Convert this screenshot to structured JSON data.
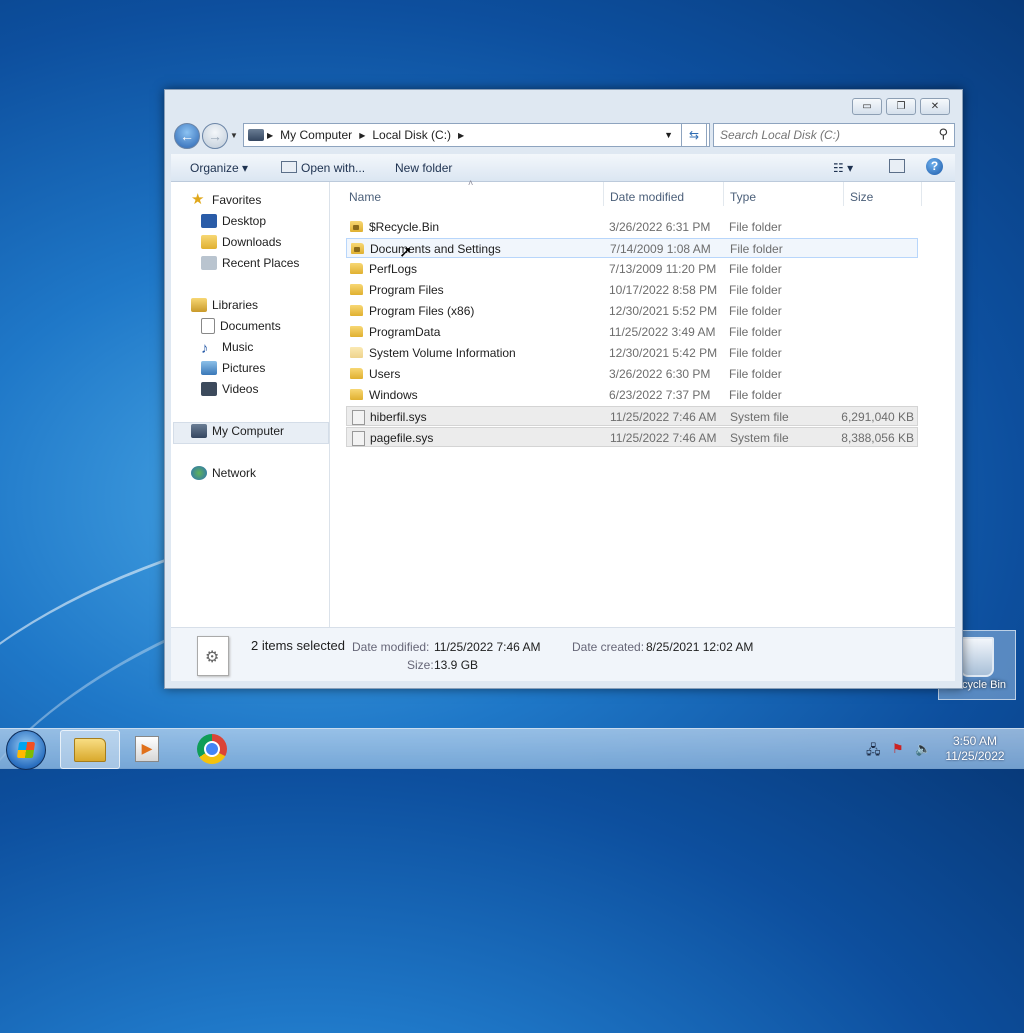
{
  "desktop": {
    "recycle_bin_label": "Recycle Bin"
  },
  "window": {
    "buttons": {
      "minimize": "▭",
      "maximize": "❐",
      "close": "✕"
    },
    "address": {
      "root": "My Computer",
      "current": "Local Disk (C:)"
    },
    "search": {
      "placeholder": "Search Local Disk (C:)"
    },
    "toolbar": {
      "organize": "Organize ▾",
      "open_with": "Open with...",
      "new_folder": "New folder",
      "help": "?"
    },
    "nav": {
      "favorites": "Favorites",
      "desktop": "Desktop",
      "downloads": "Downloads",
      "recent_places": "Recent Places",
      "libraries": "Libraries",
      "documents": "Documents",
      "music": "Music",
      "pictures": "Pictures",
      "videos": "Videos",
      "computer": "My Computer",
      "network": "Network"
    },
    "columns": {
      "name": "Name",
      "date": "Date modified",
      "type": "Type",
      "size": "Size"
    },
    "files": [
      {
        "name": "$Recycle.Bin",
        "date": "3/26/2022 6:31 PM",
        "type": "File folder",
        "size": ""
      },
      {
        "name": "Documents and Settings",
        "date": "7/14/2009 1:08 AM",
        "type": "File folder",
        "size": ""
      },
      {
        "name": "PerfLogs",
        "date": "7/13/2009 11:20 PM",
        "type": "File folder",
        "size": ""
      },
      {
        "name": "Program Files",
        "date": "10/17/2022 8:58 PM",
        "type": "File folder",
        "size": ""
      },
      {
        "name": "Program Files (x86)",
        "date": "12/30/2021 5:52 PM",
        "type": "File folder",
        "size": ""
      },
      {
        "name": "ProgramData",
        "date": "11/25/2022 3:49 AM",
        "type": "File folder",
        "size": ""
      },
      {
        "name": "System Volume Information",
        "date": "12/30/2021 5:42 PM",
        "type": "File folder",
        "size": ""
      },
      {
        "name": "Users",
        "date": "3/26/2022 6:30 PM",
        "type": "File folder",
        "size": ""
      },
      {
        "name": "Windows",
        "date": "6/23/2022 7:37 PM",
        "type": "File folder",
        "size": ""
      },
      {
        "name": "hiberfil.sys",
        "date": "11/25/2022 7:46 AM",
        "type": "System file",
        "size": "6,291,040 KB"
      },
      {
        "name": "pagefile.sys",
        "date": "11/25/2022 7:46 AM",
        "type": "System file",
        "size": "8,388,056 KB"
      }
    ],
    "details": {
      "selected": "2 items selected",
      "date_modified_label": "Date modified:",
      "date_modified": "11/25/2022 7:46 AM",
      "date_created_label": "Date created:",
      "date_created": "8/25/2021 12:02 AM",
      "size_label": "Size:",
      "size": "13.9 GB"
    }
  },
  "taskbar": {
    "time": "3:50 AM",
    "date": "11/25/2022"
  }
}
